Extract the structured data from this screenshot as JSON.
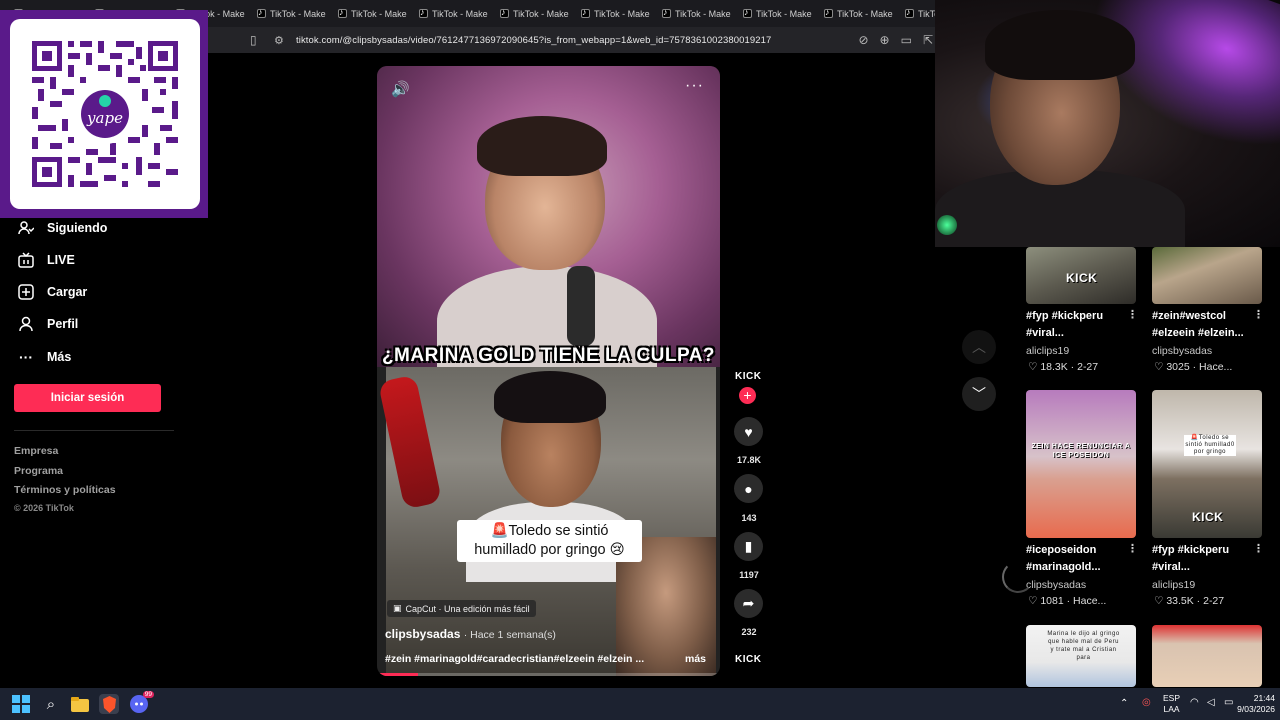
{
  "browser": {
    "tabs": [
      "Pl...",
      "TikTok - Make",
      "TikTok - Make",
      "TikTok - Make",
      "TikTok - Make",
      "TikTok - Make",
      "TikTok - Make",
      "TikTok - Make",
      "TikTok - Make",
      "TikTok - Make",
      "TikTok - Make",
      "TikTok"
    ],
    "url": "tiktok.com/@clipsbysadas/video/7612477136972090645?is_from_webapp=1&web_id=7578361002380019217"
  },
  "overlay": {
    "qr_brand": "yape"
  },
  "sidebar": {
    "items": [
      {
        "label": "Siguiendo",
        "icon": "following-icon"
      },
      {
        "label": "LIVE",
        "icon": "live-icon"
      },
      {
        "label": "Cargar",
        "icon": "upload-icon"
      },
      {
        "label": "Perfil",
        "icon": "profile-icon"
      },
      {
        "label": "Más",
        "icon": "more-icon"
      }
    ],
    "login_label": "Iniciar sesión",
    "footer": [
      "Empresa",
      "Programa",
      "Términos y políticas"
    ],
    "copyright": "© 2026 TikTok"
  },
  "video": {
    "title": "¿MARINA GOLD TIENE LA CULPA?",
    "caption_emoji": "🚨",
    "caption": "Toledo se sintió humillad0 por gringo 😢",
    "capcut": "CapCut · Una edición más fácil",
    "author": "clipsbysadas",
    "time": "· Hace 1 semana(s)",
    "tags": "#zein #marinagold#caradecristian#elzeein #elzein ...",
    "more": "más",
    "progress": 0.12
  },
  "actions": {
    "channel_label": "KICK",
    "likes": "17.8K",
    "comments": "143",
    "saves": "1197",
    "shares": "232",
    "bottom_label": "KICK"
  },
  "recommended": [
    {
      "title1": "#fyp #kickperu",
      "title2": "#viral...",
      "author": "aliclips19",
      "meta": "♡ 18.3K · 2-27",
      "thumb_label": "KICK"
    },
    {
      "title1": "#zein#westcol",
      "title2": "#elzeein #elzein...",
      "author": "clipsbysadas",
      "meta": "♡ 3025 · Hace...",
      "thumb_label": ""
    },
    {
      "title1": "#iceposeidon",
      "title2": "#marinagold...",
      "author": "clipsbysadas",
      "meta": "♡ 1081 · Hace...",
      "thumb_label": "ZEIN HACE RENUNCIAR A ICE POSEIDON"
    },
    {
      "title1": "#fyp #kickperu",
      "title2": "#viral...",
      "author": "aliclips19",
      "meta": "♡ 33.5K · 2-27",
      "thumb_label": "KICK",
      "thumb_caption": "🚨Toledo se sintió humillad0 por gringo"
    },
    {
      "title1": "",
      "title2": "",
      "author": "",
      "meta": "",
      "thumb_label": "Marina le dijo al gringo que hable mal de Peru y trate mal a Cristian para"
    },
    {
      "title1": "",
      "title2": "",
      "author": "",
      "meta": "",
      "thumb_label": ""
    }
  ],
  "taskbar": {
    "lang1": "ESP",
    "lang2": "LAA",
    "time": "21:44",
    "date": "9/03/2026",
    "badge": "99"
  }
}
